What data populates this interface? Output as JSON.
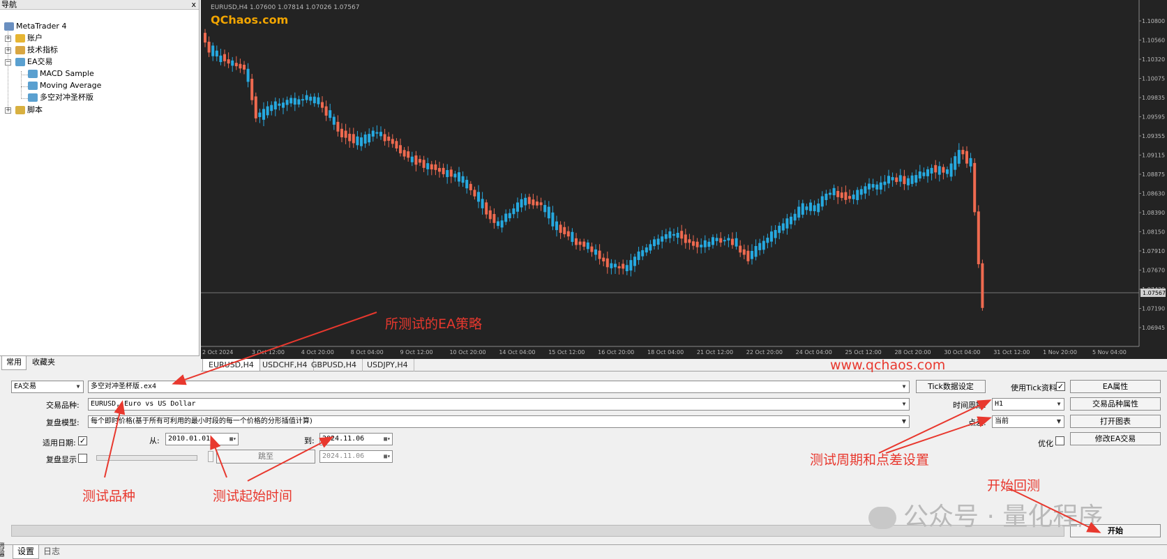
{
  "navigator": {
    "title": "导航",
    "close": "x",
    "root": "MetaTrader 4",
    "items": [
      "账户",
      "技术指标",
      "EA交易",
      "脚本"
    ],
    "ea_children": [
      "MACD Sample",
      "Moving Average",
      "多空对冲圣杯版"
    ],
    "tabs": [
      "常用",
      "收藏夹"
    ]
  },
  "chart": {
    "header": "EURUSD,H4  1.07600 1.07814 1.07026 1.07567",
    "logo": "QChaos.com",
    "price_labels": [
      "1.10800",
      "1.10560",
      "1.10320",
      "1.10075",
      "1.09835",
      "1.09595",
      "1.09355",
      "1.09115",
      "1.08875",
      "1.08630",
      "1.08390",
      "1.08150",
      "1.07910",
      "1.07670",
      "1.07430",
      "1.07190",
      "1.06945"
    ],
    "current_price": "1.07567",
    "time_labels": [
      "2 Oct 2024",
      "3 Oct 12:00",
      "4 Oct 20:00",
      "8 Oct 04:00",
      "9 Oct 12:00",
      "10 Oct 20:00",
      "14 Oct 04:00",
      "15 Oct 12:00",
      "16 Oct 20:00",
      "18 Oct 04:00",
      "21 Oct 12:00",
      "22 Oct 20:00",
      "24 Oct 04:00",
      "25 Oct 12:00",
      "28 Oct 20:00",
      "30 Oct 04:00",
      "31 Oct 12:00",
      "1 Nov 20:00",
      "5 Nov 04:00"
    ],
    "tabs": [
      "EURUSD,H4",
      "USDCHF,H4",
      "GBPUSD,H4",
      "USDJPY,H4"
    ],
    "bull_color": "#26a9e0",
    "bear_color": "#ef6a50"
  },
  "tester": {
    "ea_type": "EA交易",
    "ea_file": "多空对冲圣杯版.ex4",
    "symbol_label": "交易品种:",
    "symbol": "EURUSD, Euro vs US Dollar",
    "model_label": "复盘模型:",
    "model": "每个即时价格(基于所有可利用的最小时段的每一个价格的分形插值计算)",
    "use_date_label": "适用日期:",
    "from_label": "从:",
    "from": "2010.01.01",
    "to_label": "到:",
    "to": "2024.11.06",
    "visual_label": "复盘显示",
    "jump_label": "跳至",
    "jump_date": "2024.11.06",
    "tick_btn": "Tick数据设定",
    "use_tick_label": "使用Tick资料",
    "period_label": "时间周期:",
    "period": "H1",
    "spread_label": "点差:",
    "spread": "当前",
    "optimize_label": "优化",
    "buttons": [
      "EA属性",
      "交易品种属性",
      "打开图表",
      "修改EA交易"
    ],
    "start": "开始",
    "tabs": [
      "设置",
      "日志"
    ],
    "side_label": "测试器"
  },
  "annotations": {
    "ea": "所测试的EA策略",
    "url": "www.qchaos.com",
    "symbol": "测试品种",
    "start_time": "测试起始时间",
    "period": "测试周期和点差设置",
    "begin": "开始回测",
    "watermark": "公众号 · 量化程序"
  }
}
